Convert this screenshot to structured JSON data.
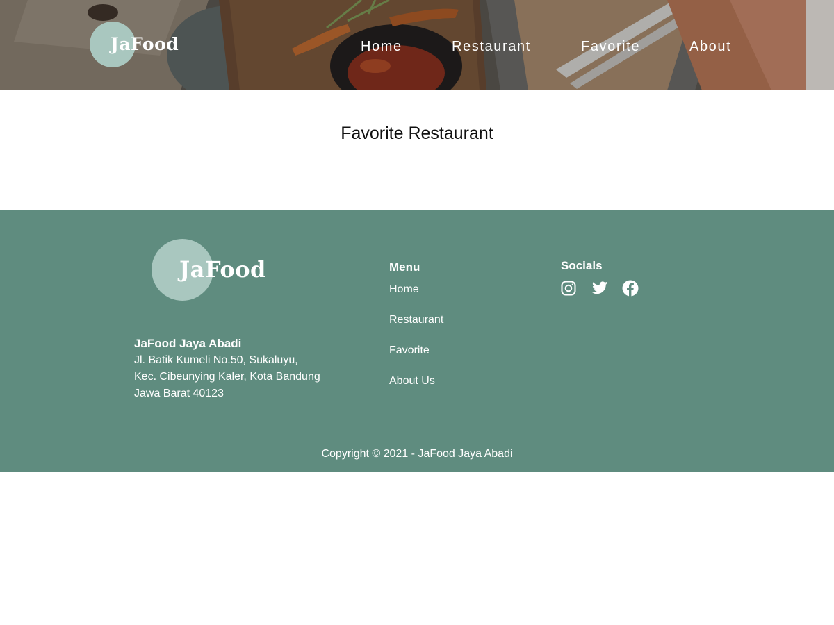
{
  "brand": {
    "logo_text": "JaFood",
    "logo_circle_color": "#a9c7bf"
  },
  "nav": {
    "items": [
      {
        "label": "Home"
      },
      {
        "label": "Restaurant"
      },
      {
        "label": "Favorite"
      },
      {
        "label": "About"
      }
    ]
  },
  "main": {
    "title": "Favorite Restaurant"
  },
  "footer": {
    "background_color": "#5f8c7f",
    "company_name": "JaFood Jaya Abadi",
    "address_lines": [
      "Jl. Batik Kumeli No.50, Sukaluyu,",
      "Kec. Cibeunying Kaler, Kota Bandung",
      "Jawa Barat 40123"
    ],
    "menu_title": "Menu",
    "menu_items": [
      {
        "label": "Home"
      },
      {
        "label": "Restaurant"
      },
      {
        "label": "Favorite"
      },
      {
        "label": "About Us"
      }
    ],
    "socials_title": "Socials",
    "socials": [
      {
        "icon": "instagram-icon"
      },
      {
        "icon": "twitter-icon"
      },
      {
        "icon": "facebook-icon"
      }
    ],
    "copyright": "Copyright © 2021 - JaFood Jaya Abadi"
  }
}
